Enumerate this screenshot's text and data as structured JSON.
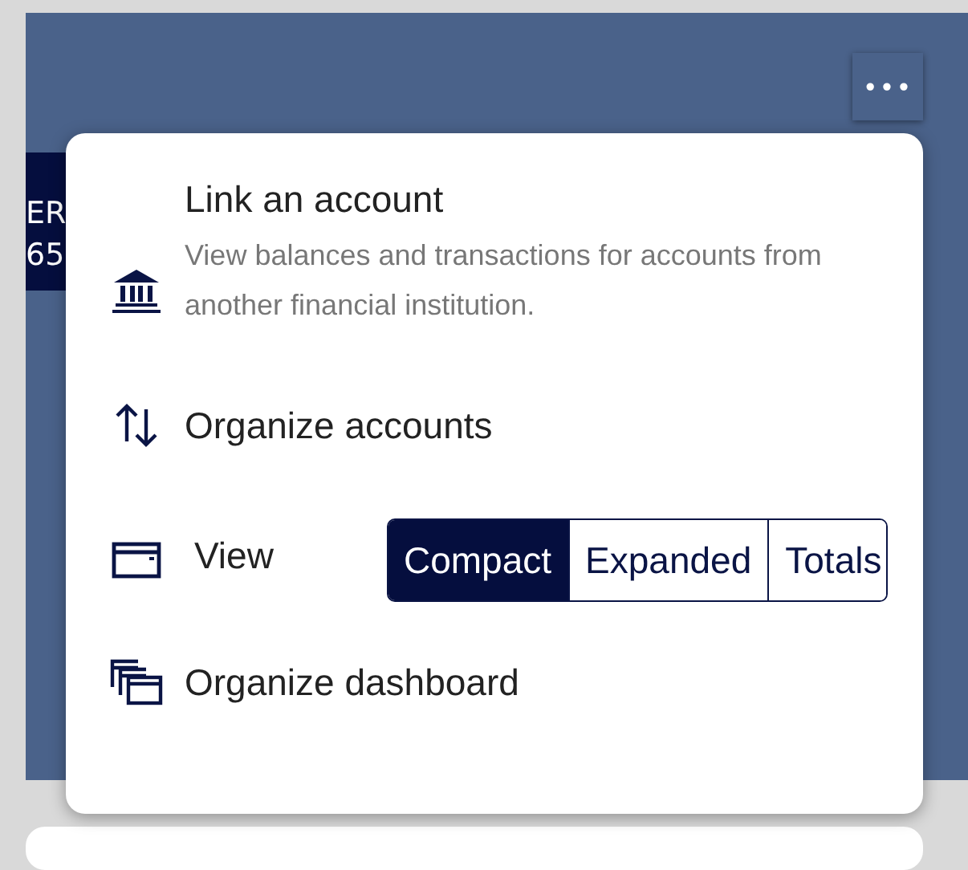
{
  "background_card": {
    "line_1": "ER",
    "line_2": "65"
  },
  "more_button": {
    "label": "•••"
  },
  "menu": {
    "items": [
      {
        "kind": "detail",
        "title": "Link an account",
        "description": "View balances and transactions for accounts from another financial institution."
      },
      {
        "kind": "action",
        "title": "Organize accounts"
      },
      {
        "kind": "view",
        "title": "View",
        "options": [
          {
            "label": "Compact",
            "selected": true
          },
          {
            "label": "Expanded",
            "selected": false
          },
          {
            "label": "Totals",
            "selected": false
          }
        ]
      },
      {
        "kind": "action",
        "title": "Organize dashboard"
      }
    ]
  }
}
